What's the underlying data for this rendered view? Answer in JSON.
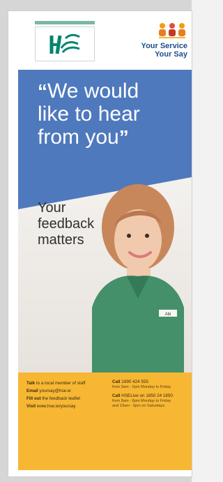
{
  "header": {
    "your_service_line1": "Your Service",
    "your_service_line2": "Your Say"
  },
  "headline": {
    "open_quote": "“",
    "line1": "We would",
    "line2": "like to hear",
    "line3": "from you",
    "close_quote": "”"
  },
  "subheadline": {
    "line1": "Your",
    "line2": "feedback",
    "line3": "matters"
  },
  "badge": {
    "text": "Abi"
  },
  "contact_left": [
    {
      "bold": "Talk",
      "rest": " to a local member of staff"
    },
    {
      "bold": "Email",
      "rest": " yoursay@hse.ie"
    },
    {
      "bold": "Fill out",
      "rest": " the feedback leaflet"
    },
    {
      "bold": "Visit",
      "rest": " www.hse.ie/yoursay"
    }
  ],
  "contact_right": {
    "call1_bold": "Call",
    "call1_rest": " 1890 424 555",
    "call1_sub": "from 9am - 5pm Monday to Friday",
    "call2_bold": "Call",
    "call2_rest": " HSELive on 1850 24 1850",
    "call2_sub1": "from 8am - 8pm Monday to Friday",
    "call2_sub2": "and 10am - 5pm on Saturdays"
  },
  "colors": {
    "brand_green": "#00856f",
    "blue_block": "#4f79bd",
    "footer_orange": "#f7b733",
    "navy_text": "#1f4d8a"
  }
}
